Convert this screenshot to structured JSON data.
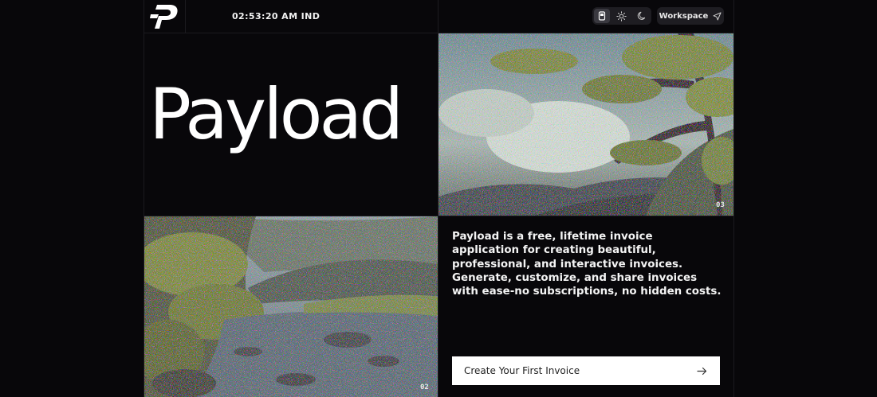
{
  "header": {
    "logo_icon": "payload-logo-icon",
    "clock": "02:53:20 AM IND",
    "theme_options": [
      "system-icon",
      "sun-icon",
      "moon-icon"
    ],
    "active_theme": "system",
    "workspace_label": "Workspace",
    "workspace_icon": "send-icon"
  },
  "hero": {
    "title": "Payload",
    "image_top_number": "03",
    "image_bottom_number": "02",
    "description": "Payload is a free, lifetime invoice application for creating beautiful, professional, and interactive invoices. Generate, customize, and share invoices with ease-no subscriptions, no hidden costs.",
    "cta_label": "Create Your First Invoice",
    "cta_icon": "arrow-right-icon"
  },
  "colors": {
    "background": "#08070a",
    "grid_line": "#1b1a1f",
    "button_dark": "#1e1d22",
    "cta_bg": "#ffffff"
  }
}
